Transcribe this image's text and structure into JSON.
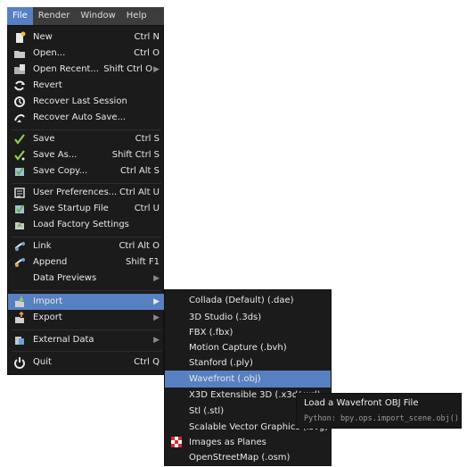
{
  "menubar": {
    "items": [
      "File",
      "Render",
      "Window",
      "Help"
    ],
    "active": "File"
  },
  "file_menu": {
    "items": [
      {
        "label": "New",
        "shortcut": "Ctrl N",
        "icon": "new-file-icon"
      },
      {
        "label": "Open...",
        "shortcut": "Ctrl O",
        "icon": "folder-icon"
      },
      {
        "label": "Open Recent...",
        "shortcut": "Shift Ctrl O",
        "icon": "open-recent-icon"
      },
      {
        "label": "Revert",
        "shortcut": "",
        "icon": "revert-icon"
      },
      {
        "label": "Recover Last Session",
        "shortcut": "",
        "icon": "recover-icon"
      },
      {
        "label": "Recover Auto Save...",
        "shortcut": "",
        "icon": "recover-auto-icon"
      },
      {
        "label": "Save",
        "shortcut": "Ctrl S",
        "icon": "checkmark-icon"
      },
      {
        "label": "Save As...",
        "shortcut": "Shift Ctrl S",
        "icon": "checkmark-icon"
      },
      {
        "label": "Save Copy...",
        "shortcut": "Ctrl Alt S",
        "icon": "save-copy-icon"
      },
      {
        "label": "User Preferences...",
        "shortcut": "Ctrl Alt U",
        "icon": "preferences-icon"
      },
      {
        "label": "Save Startup File",
        "shortcut": "Ctrl U",
        "icon": "save-startup-icon"
      },
      {
        "label": "Load Factory Settings",
        "shortcut": "",
        "icon": "load-factory-icon"
      },
      {
        "label": "Link",
        "shortcut": "Ctrl Alt O",
        "icon": "link-icon"
      },
      {
        "label": "Append",
        "shortcut": "Shift F1",
        "icon": "append-icon"
      },
      {
        "label": "Data Previews",
        "shortcut": "",
        "icon": ""
      },
      {
        "label": "Import",
        "shortcut": "",
        "icon": "import-icon"
      },
      {
        "label": "Export",
        "shortcut": "",
        "icon": "export-icon"
      },
      {
        "label": "External Data",
        "shortcut": "",
        "icon": "external-data-icon"
      },
      {
        "label": "Quit",
        "shortcut": "Ctrl Q",
        "icon": "power-icon"
      }
    ]
  },
  "import_menu": {
    "items": [
      "Collada (Default) (.dae)",
      "3D Studio (.3ds)",
      "FBX (.fbx)",
      "Motion Capture (.bvh)",
      "Stanford (.ply)",
      "Wavefront (.obj)",
      "X3D Extensible 3D (.x3d/.wrl)",
      "Stl (.stl)",
      "Scalable Vector Graphics (.svg)",
      "Images as Planes",
      "OpenStreetMap (.osm)"
    ],
    "highlighted": "Wavefront (.obj)"
  },
  "tooltip": {
    "title": "Load a Wavefront OBJ File",
    "python": "Python: bpy.ops.import_scene.obj()"
  },
  "colors": {
    "menu_bg": "#1b1b1b",
    "highlight": "#5680c2",
    "text": "#e8e8e8"
  }
}
